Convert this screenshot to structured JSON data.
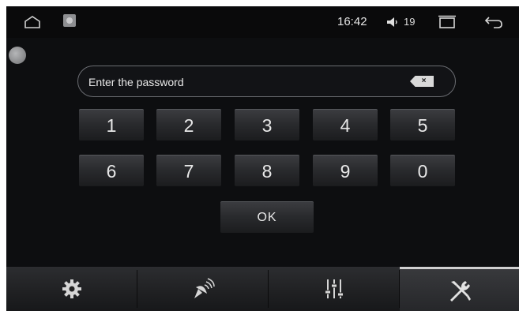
{
  "status_bar": {
    "time": "16:42",
    "volume": "19",
    "icons": [
      "home-icon",
      "app-icon",
      "volume-icon",
      "recent-apps-icon",
      "back-icon"
    ]
  },
  "password": {
    "placeholder": "Enter the password",
    "clear_label": "×"
  },
  "keypad": {
    "row1": [
      "1",
      "2",
      "3",
      "4",
      "5"
    ],
    "row2": [
      "6",
      "7",
      "8",
      "9",
      "0"
    ],
    "ok": "OK"
  },
  "tabs": [
    {
      "icon": "gear-icon",
      "active": false
    },
    {
      "icon": "satellite-icon",
      "active": false
    },
    {
      "icon": "equalizer-icon",
      "active": false
    },
    {
      "icon": "tools-icon",
      "active": true
    }
  ],
  "colors": {
    "background": "#0d0e10",
    "key_text": "#e8e8e8",
    "active_tab_indicator": "#d0d0d0"
  }
}
